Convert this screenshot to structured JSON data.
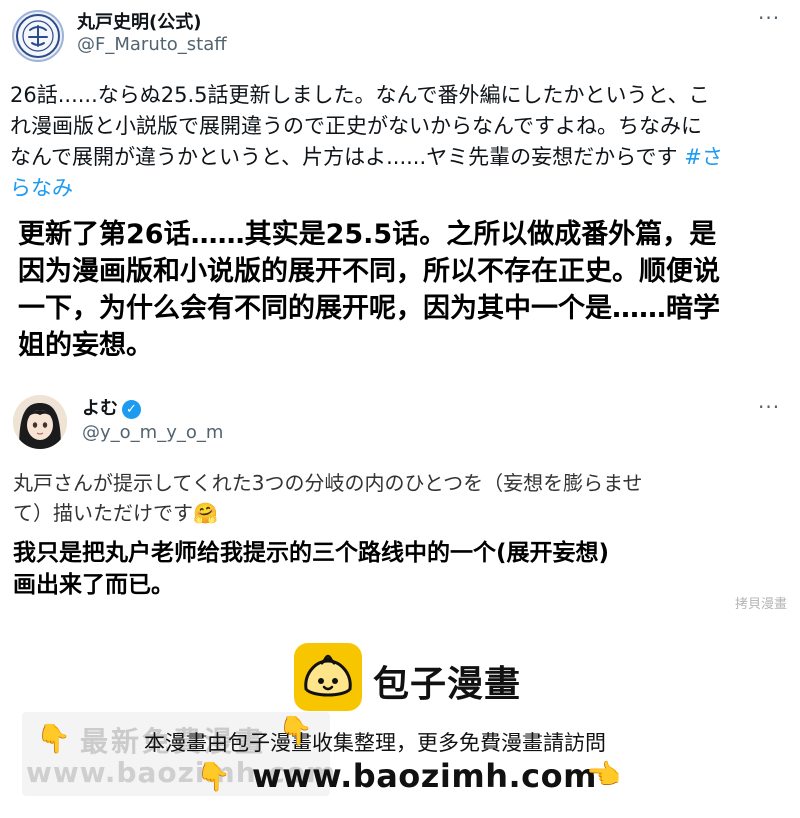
{
  "tweet1": {
    "name": "丸戸史明(公式)",
    "handle": "@F_Maruto_staff",
    "more_label": "···",
    "avatar_icon": "seal-logo-icon",
    "text_lines": [
      "26話......ならぬ25.5話更新しました。なんで番外編にしたかというと、こ",
      "れ漫画版と小説版で展開違うので正史がないからなんですよね。ちなみに",
      "なんで展開が違うかというと、片方はよ......ヤミ先輩の妄想だからです"
    ],
    "hashtag_part1": "#さ",
    "hashtag_part2": "らなみ",
    "translation_lines": [
      "更新了第26话……其实是25.5话。之所以做成番外篇，是",
      "因为漫画版和小说版的展开不同，所以不存在正史。顺便说",
      "一下，为什么会有不同的展开呢，因为其中一个是……暗学",
      "姐的妄想。"
    ]
  },
  "tweet2": {
    "name": "よむ",
    "verified_icon": "verified-badge-icon",
    "handle": "@y_o_m_y_o_m",
    "more_label": "···",
    "text_lines": [
      "丸戸さんが提示してくれた3つの分岐の内のひとつを（妄想を膨らませ",
      "て）描いただけです"
    ],
    "emoji": "🤗",
    "translation_lines": [
      "我只是把丸户老师给我提示的三个路线中的一个(展开妄想)",
      "画出来了而已。"
    ],
    "watermark": "拷貝漫畫"
  },
  "footer": {
    "brand": "包子漫畫",
    "notice": "本漫畫由包子漫畫收集整理，更多免費漫畫請訪問",
    "url": "www.baozimh.com",
    "hand_down": "👇",
    "hand_point": "👈",
    "ghost_line1": "最新免費漫畫",
    "ghost_line2": "www.baozimh.com"
  },
  "colors": {
    "link": "#1d9bf0",
    "secondary_text": "#536471",
    "logo_yellow": "#f7c600"
  }
}
